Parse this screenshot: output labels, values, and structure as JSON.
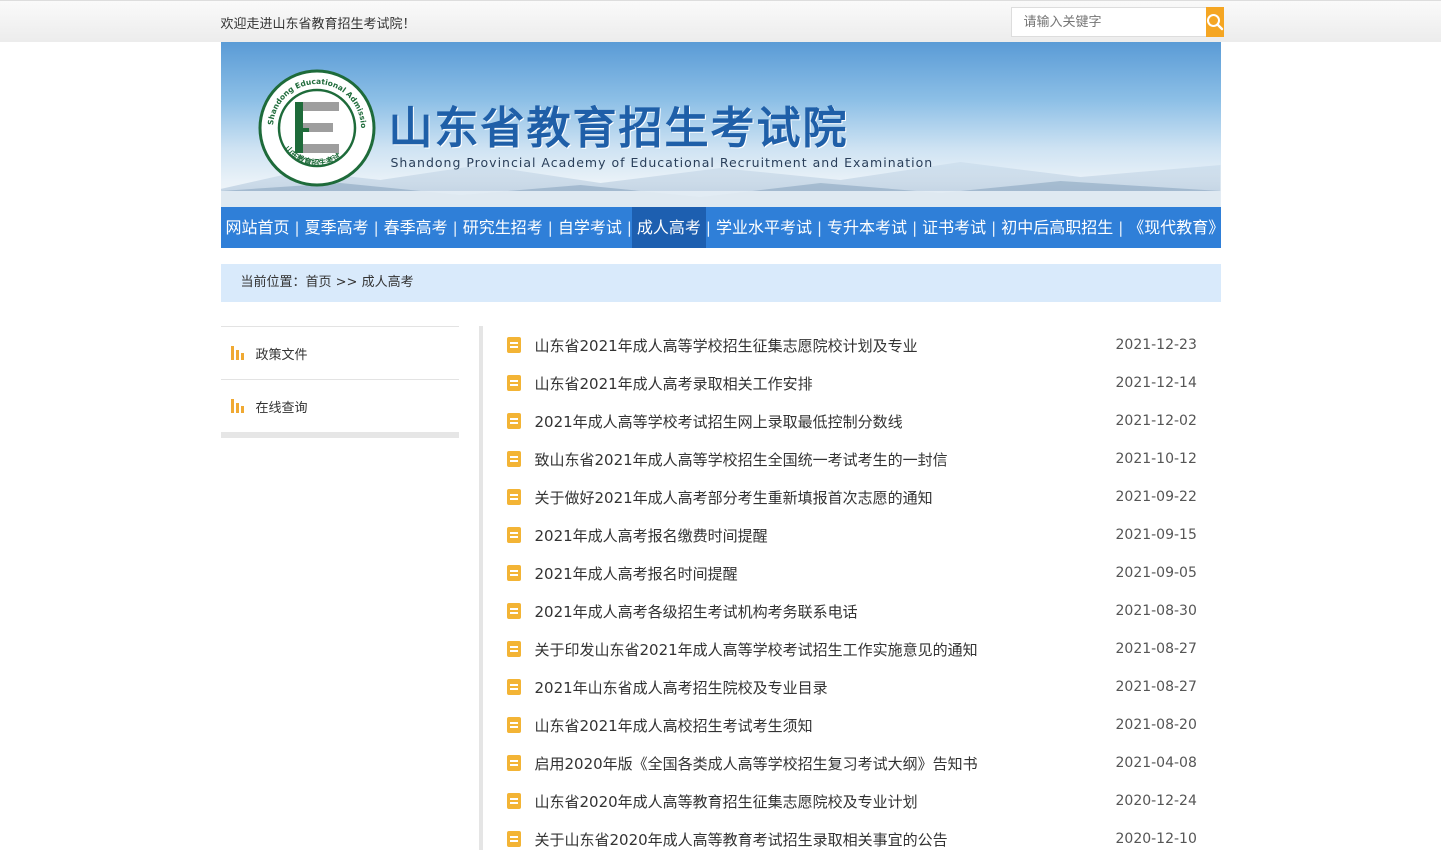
{
  "header": {
    "welcome": "欢迎走进山东省教育招生考试院！",
    "search_placeholder": "请输入关键字"
  },
  "banner": {
    "title": "山东省教育招生考试院",
    "subtitle": "Shandong Provincial Academy of Educational Recruitment and Examination",
    "logo_ring_text": "Shandong Educational Admission & Examinations",
    "logo_bottom_text": "山东教育招生考试"
  },
  "nav": {
    "items": [
      "网站首页",
      "夏季高考",
      "春季高考",
      "研究生招考",
      "自学考试",
      "成人高考",
      "学业水平考试",
      "专升本考试",
      "证书考试",
      "初中后高职招生",
      "《现代教育》"
    ],
    "active_index": 5
  },
  "breadcrumb": {
    "label": "当前位置：",
    "path": "首页 >> 成人高考"
  },
  "sidebar": {
    "items": [
      {
        "label": "政策文件"
      },
      {
        "label": "在线查询"
      }
    ]
  },
  "articles": [
    {
      "title": "山东省2021年成人高等学校招生征集志愿院校计划及专业",
      "date": "2021-12-23"
    },
    {
      "title": "山东省2021年成人高考录取相关工作安排",
      "date": "2021-12-14"
    },
    {
      "title": "2021年成人高等学校考试招生网上录取最低控制分数线",
      "date": "2021-12-02"
    },
    {
      "title": "致山东省2021年成人高等学校招生全国统一考试考生的一封信",
      "date": "2021-10-12"
    },
    {
      "title": "关于做好2021年成人高考部分考生重新填报首次志愿的通知",
      "date": "2021-09-22"
    },
    {
      "title": "2021年成人高考报名缴费时间提醒",
      "date": "2021-09-15"
    },
    {
      "title": "2021年成人高考报名时间提醒",
      "date": "2021-09-05"
    },
    {
      "title": "2021年成人高考各级招生考试机构考务联系电话",
      "date": "2021-08-30"
    },
    {
      "title": "关于印发山东省2021年成人高等学校考试招生工作实施意见的通知",
      "date": "2021-08-27"
    },
    {
      "title": "2021年山东省成人高考招生院校及专业目录",
      "date": "2021-08-27"
    },
    {
      "title": "山东省2021年成人高校招生考试考生须知",
      "date": "2021-08-20"
    },
    {
      "title": "启用2020年版《全国各类成人高等学校招生复习考试大纲》告知书",
      "date": "2021-04-08"
    },
    {
      "title": "山东省2020年成人高等教育招生征集志愿院校及专业计划",
      "date": "2020-12-24"
    },
    {
      "title": "关于山东省2020年成人高等教育考试招生录取相关事宜的公告",
      "date": "2020-12-10"
    }
  ],
  "colors": {
    "nav_bg": "#2f7fd8",
    "nav_active": "#1d5fb0",
    "accent": "#f5a623",
    "breadcrumb_bg": "#d9eafb",
    "title_blue": "#1f5fa8"
  },
  "icons": {
    "search": "search-icon",
    "sidebar": "bar-chart-icon",
    "article": "document-icon"
  }
}
